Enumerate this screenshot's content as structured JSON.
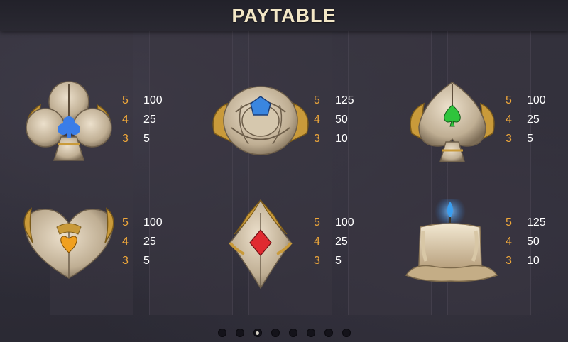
{
  "header": {
    "title": "PAYTABLE"
  },
  "symbols": [
    {
      "name": "club",
      "gem_color": "#3a7de8",
      "pays": [
        {
          "count": "5",
          "value": "100"
        },
        {
          "count": "4",
          "value": "25"
        },
        {
          "count": "3",
          "value": "5"
        }
      ]
    },
    {
      "name": "rose",
      "gem_color": "#3a86e0",
      "pays": [
        {
          "count": "5",
          "value": "125"
        },
        {
          "count": "4",
          "value": "50"
        },
        {
          "count": "3",
          "value": "10"
        }
      ]
    },
    {
      "name": "spade",
      "gem_color": "#2fc43c",
      "pays": [
        {
          "count": "5",
          "value": "100"
        },
        {
          "count": "4",
          "value": "25"
        },
        {
          "count": "3",
          "value": "5"
        }
      ]
    },
    {
      "name": "heart",
      "gem_color": "#f0a020",
      "pays": [
        {
          "count": "5",
          "value": "100"
        },
        {
          "count": "4",
          "value": "25"
        },
        {
          "count": "3",
          "value": "5"
        }
      ]
    },
    {
      "name": "diamond",
      "gem_color": "#e02a30",
      "pays": [
        {
          "count": "5",
          "value": "100"
        },
        {
          "count": "4",
          "value": "25"
        },
        {
          "count": "3",
          "value": "5"
        }
      ]
    },
    {
      "name": "candle",
      "gem_color": "#3a9ef0",
      "pays": [
        {
          "count": "5",
          "value": "125"
        },
        {
          "count": "4",
          "value": "50"
        },
        {
          "count": "3",
          "value": "10"
        }
      ]
    }
  ],
  "pagination": {
    "total": 8,
    "active_index": 2
  },
  "colors": {
    "count": "#f0a83a",
    "value": "#ffffff",
    "title": "#f3e7c6"
  }
}
